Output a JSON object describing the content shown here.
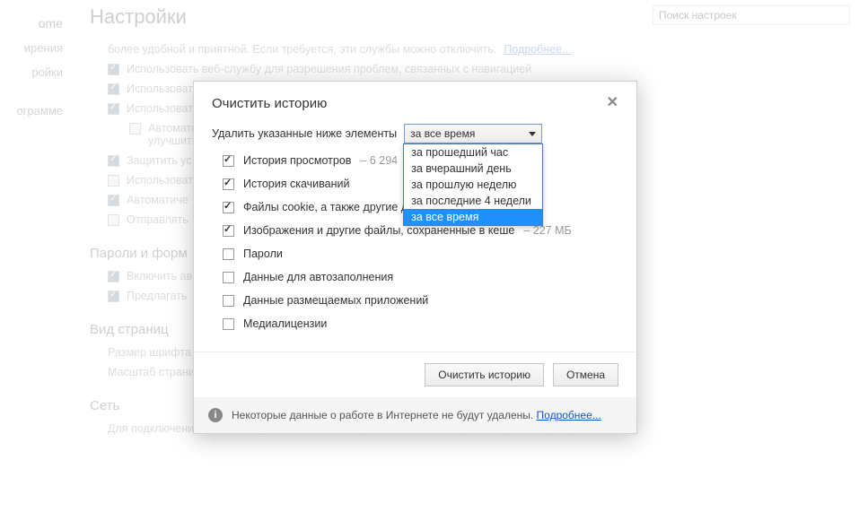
{
  "sidebar": {
    "brand": "ome",
    "items": [
      "ирения",
      "ройки",
      "ограмме"
    ]
  },
  "page": {
    "title": "Настройки",
    "search_placeholder": "Поиск настроек",
    "top_line_fragment": "более удобной и приятной. Если требуется, эти службы можно отключить.",
    "top_link": "Подробнее...",
    "settings": [
      {
        "checked": true,
        "label": "Использовать веб-службу для разрешения проблем, связанных с навигацией"
      },
      {
        "checked": true,
        "label": "Использоват"
      },
      {
        "checked": true,
        "label": "Использоват"
      },
      {
        "checked": false,
        "label": "Автоматиче",
        "extra": "улучшить ра",
        "indent": true
      },
      {
        "checked": true,
        "label": "Защитить ус"
      },
      {
        "checked": false,
        "label": "Использоват"
      },
      {
        "checked": true,
        "label": "Автоматиче"
      },
      {
        "checked": false,
        "label": "Отправлять"
      }
    ],
    "section_passwords": "Пароли и форм",
    "pw_items": [
      {
        "checked": true,
        "label": "Включить ав"
      },
      {
        "checked": true,
        "label": "Предлагать"
      }
    ],
    "section_view": "Вид страниц",
    "view_items": [
      "Размер шрифта",
      "Масштаб страни"
    ],
    "section_net": "Сеть",
    "net_line": "Для подключения к сети Google Chrome использует системные настройки прокси-сервера"
  },
  "dialog": {
    "title": "Очистить историю",
    "delete_label": "Удалить указанные ниже элементы",
    "select_value": "за все время",
    "dropdown": [
      "за прошедший час",
      "за вчерашний день",
      "за прошлую неделю",
      "за последние 4 недели",
      "за все время"
    ],
    "selected_index": 4,
    "options": [
      {
        "checked": true,
        "label": "История просмотров",
        "suffix": " – 6 294"
      },
      {
        "checked": true,
        "label": "История скачиваний",
        "suffix": ""
      },
      {
        "checked": true,
        "label": "Файлы cookie, а также другие д",
        "suffix": ""
      },
      {
        "checked": true,
        "label": "Изображения и другие файлы, сохраненные в кеше",
        "suffix": " – 227 МБ"
      },
      {
        "checked": false,
        "label": "Пароли",
        "suffix": ""
      },
      {
        "checked": false,
        "label": "Данные для автозаполнения",
        "suffix": ""
      },
      {
        "checked": false,
        "label": "Данные размещаемых приложений",
        "suffix": ""
      },
      {
        "checked": false,
        "label": "Медиалицензии",
        "suffix": ""
      }
    ],
    "primary_btn": "Очистить историю",
    "cancel_btn": "Отмена",
    "info_text": "Некоторые данные о работе в Интернете не будут удалены. ",
    "info_link": "Подробнее..."
  }
}
